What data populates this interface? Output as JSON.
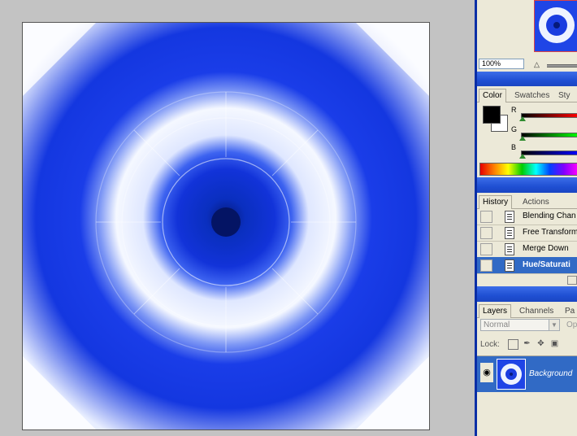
{
  "navigator": {
    "zoom": "100%"
  },
  "color_panel": {
    "tabs": [
      "Color",
      "Swatches",
      "Sty"
    ],
    "channels": [
      "R",
      "G",
      "B"
    ],
    "colors": {
      "foreground": "#000000",
      "background": "#ffffff"
    }
  },
  "history_panel": {
    "tabs": [
      "History",
      "Actions"
    ],
    "items": [
      "Blending Chan",
      "Free Transform",
      "Merge Down",
      "Hue/Saturati"
    ],
    "selected_index": 3
  },
  "layers_panel": {
    "tabs": [
      "Layers",
      "Channels",
      "Pa"
    ],
    "blend_mode": "Normal",
    "opacity_label": "Op",
    "lock_label": "Lock:",
    "layer_name": "Background"
  },
  "icons": [
    "zoom-out-icon",
    "lock-transparency-icon",
    "lock-paint-icon",
    "lock-move-icon",
    "lock-all-icon",
    "eye-icon",
    "history-state-icon"
  ]
}
